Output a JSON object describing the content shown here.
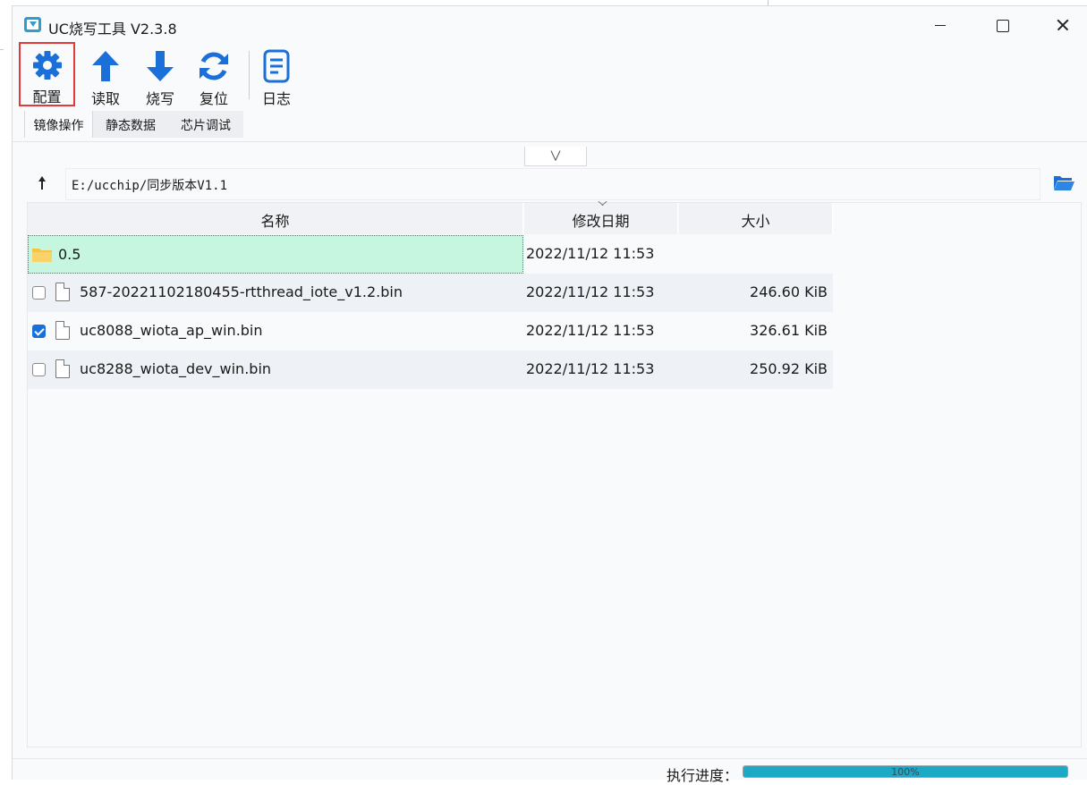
{
  "window": {
    "title": "UC烧写工具 V2.3.8"
  },
  "toolbar": {
    "config_label": "配置",
    "read_label": "读取",
    "write_label": "烧写",
    "reset_label": "复位",
    "log_label": "日志"
  },
  "tabs": [
    {
      "label": "镜像操作",
      "active": true
    },
    {
      "label": "静态数据",
      "active": false
    },
    {
      "label": "芯片调试",
      "active": false
    }
  ],
  "path": {
    "value": "E:/ucchip/同步版本V1.1"
  },
  "file_list": {
    "columns": [
      "名称",
      "修改日期",
      "大小"
    ],
    "rows": [
      {
        "type": "folder",
        "name": "0.5",
        "date": "2022/11/12 11:53",
        "size": "",
        "checked": false
      },
      {
        "type": "file",
        "name": "587-20221102180455-rtthread_iote_v1.2.bin",
        "date": "2022/11/12 11:53",
        "size": "246.60 KiB",
        "checked": false
      },
      {
        "type": "file",
        "name": "uc8088_wiota_ap_win.bin",
        "date": "2022/11/12 11:53",
        "size": "326.61 KiB",
        "checked": true
      },
      {
        "type": "file",
        "name": "uc8288_wiota_dev_win.bin",
        "date": "2022/11/12 11:53",
        "size": "250.92 KiB",
        "checked": false
      }
    ]
  },
  "status": {
    "progress_label": "执行进度：",
    "progress_percent": 100,
    "progress_text": "100%"
  },
  "colors": {
    "accent": "#1b6fd8",
    "icon_blue": "#1b6fd8",
    "progress": "#1ba9c5",
    "selected_row": "#c6f6e0",
    "highlight_border": "#e23a3a",
    "folder": "#f6c445"
  },
  "icons": {
    "config": "gear-icon",
    "read": "arrow-up-icon",
    "write": "arrow-down-icon",
    "reset": "refresh-icon",
    "log": "document-list-icon",
    "open_folder": "folder-open-icon"
  }
}
